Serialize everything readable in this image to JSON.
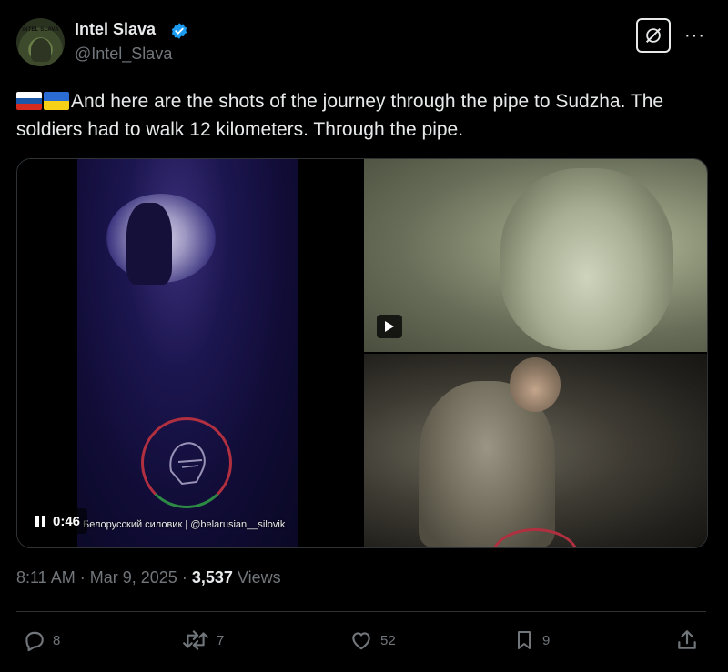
{
  "author": {
    "name": "Intel Slava",
    "handle": "@Intel_Slava",
    "avatar_text": "INTEL SLAVA",
    "verified_color": "#1d9bf0"
  },
  "header": {
    "grok_icon": "grok-icon",
    "more_icon": "more-icon",
    "more_label": "···"
  },
  "tweet": {
    "flags": [
      "russia-flag",
      "ukraine-flag"
    ],
    "text": "And here are the shots of the journey through the pipe to Sudzha. The soldiers had to walk 12 kilometers. Through the pipe."
  },
  "media": {
    "video": {
      "duration": "0:46",
      "watermark": "Белорусский силовик | @belarusian__silovik",
      "state_icon": "pause-icon"
    },
    "image_top": {
      "badge_icon": "play-icon"
    },
    "image_bottom": {}
  },
  "meta": {
    "time": "8:11 AM",
    "separator": "·",
    "date": "Mar 9, 2025",
    "views_count": "3,537",
    "views_label": "Views"
  },
  "actions": {
    "replies": "8",
    "reposts": "7",
    "likes": "52",
    "bookmarks": "9"
  },
  "colors": {
    "background": "#000000",
    "text": "#e7e9ea",
    "muted": "#71767b",
    "accent": "#1d9bf0"
  }
}
